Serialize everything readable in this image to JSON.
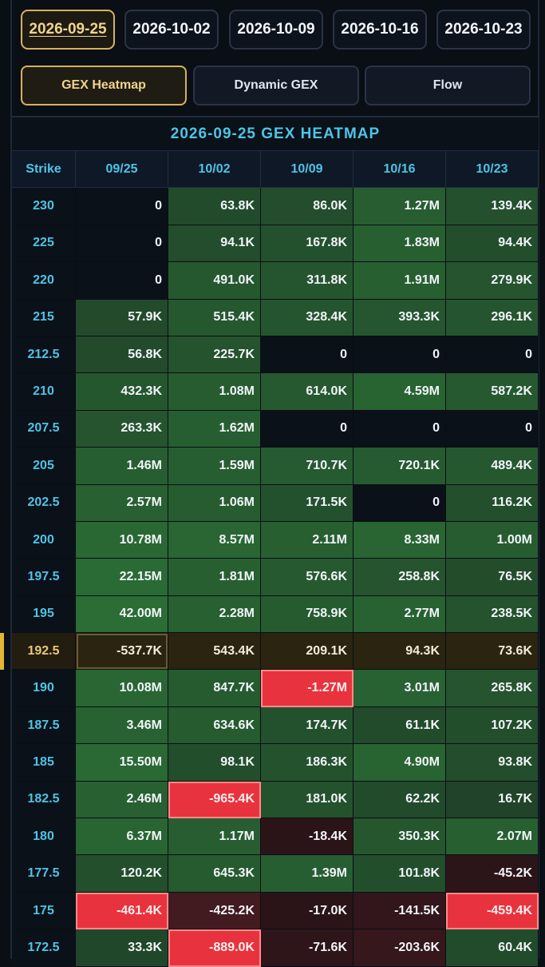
{
  "date_tabs": [
    {
      "label": "2026-09-25",
      "active": true
    },
    {
      "label": "2026-10-02",
      "active": false
    },
    {
      "label": "2026-10-09",
      "active": false
    },
    {
      "label": "2026-10-16",
      "active": false
    },
    {
      "label": "2026-10-23",
      "active": false
    }
  ],
  "view_tabs": [
    {
      "label": "GEX Heatmap",
      "active": true
    },
    {
      "label": "Dynamic GEX",
      "active": false
    },
    {
      "label": "Flow",
      "active": false
    }
  ],
  "heatmap": {
    "title": "2026-09-25 GEX HEATMAP",
    "strike_header": "Strike",
    "columns": [
      "09/25",
      "10/02",
      "10/09",
      "10/16",
      "10/23"
    ],
    "current_strike": "192.5",
    "rows": [
      {
        "strike": "230",
        "values": [
          "0",
          "63.8K",
          "86.0K",
          "1.27M",
          "139.4K"
        ],
        "numeric": [
          0,
          63800,
          86000,
          1270000,
          139400
        ]
      },
      {
        "strike": "225",
        "values": [
          "0",
          "94.1K",
          "167.8K",
          "1.83M",
          "94.4K"
        ],
        "numeric": [
          0,
          94100,
          167800,
          1830000,
          94400
        ]
      },
      {
        "strike": "220",
        "values": [
          "0",
          "491.0K",
          "311.8K",
          "1.91M",
          "279.9K"
        ],
        "numeric": [
          0,
          491000,
          311800,
          1910000,
          279900
        ]
      },
      {
        "strike": "215",
        "values": [
          "57.9K",
          "515.4K",
          "328.4K",
          "393.3K",
          "296.1K"
        ],
        "numeric": [
          57900,
          515400,
          328400,
          393300,
          296100
        ]
      },
      {
        "strike": "212.5",
        "values": [
          "56.8K",
          "225.7K",
          "0",
          "0",
          "0"
        ],
        "numeric": [
          56800,
          225700,
          0,
          0,
          0
        ]
      },
      {
        "strike": "210",
        "values": [
          "432.3K",
          "1.08M",
          "614.0K",
          "4.59M",
          "587.2K"
        ],
        "numeric": [
          432300,
          1080000,
          614000,
          4590000,
          587200
        ]
      },
      {
        "strike": "207.5",
        "values": [
          "263.3K",
          "1.62M",
          "0",
          "0",
          "0"
        ],
        "numeric": [
          263300,
          1620000,
          0,
          0,
          0
        ]
      },
      {
        "strike": "205",
        "values": [
          "1.46M",
          "1.59M",
          "710.7K",
          "720.1K",
          "489.4K"
        ],
        "numeric": [
          1460000,
          1590000,
          710700,
          720100,
          489400
        ]
      },
      {
        "strike": "202.5",
        "values": [
          "2.57M",
          "1.06M",
          "171.5K",
          "0",
          "116.2K"
        ],
        "numeric": [
          2570000,
          1060000,
          171500,
          0,
          116200
        ]
      },
      {
        "strike": "200",
        "values": [
          "10.78M",
          "8.57M",
          "2.11M",
          "8.33M",
          "1.00M"
        ],
        "numeric": [
          10780000,
          8570000,
          2110000,
          8330000,
          1000000
        ]
      },
      {
        "strike": "197.5",
        "values": [
          "22.15M",
          "1.81M",
          "576.6K",
          "258.8K",
          "76.5K"
        ],
        "numeric": [
          22150000,
          1810000,
          576600,
          258800,
          76500
        ]
      },
      {
        "strike": "195",
        "values": [
          "42.00M",
          "2.28M",
          "758.9K",
          "2.77M",
          "238.5K"
        ],
        "numeric": [
          42000000,
          2280000,
          758900,
          2770000,
          238500
        ]
      },
      {
        "strike": "192.5",
        "values": [
          "-537.7K",
          "543.4K",
          "209.1K",
          "94.3K",
          "73.6K"
        ],
        "numeric": [
          -537700,
          543400,
          209100,
          94300,
          73600
        ]
      },
      {
        "strike": "190",
        "values": [
          "10.08M",
          "847.7K",
          "-1.27M",
          "3.01M",
          "265.8K"
        ],
        "numeric": [
          10080000,
          847700,
          -1270000,
          3010000,
          265800
        ]
      },
      {
        "strike": "187.5",
        "values": [
          "3.46M",
          "634.6K",
          "174.7K",
          "61.1K",
          "107.2K"
        ],
        "numeric": [
          3460000,
          634600,
          174700,
          61100,
          107200
        ]
      },
      {
        "strike": "185",
        "values": [
          "15.50M",
          "98.1K",
          "186.3K",
          "4.90M",
          "93.8K"
        ],
        "numeric": [
          15500000,
          98100,
          186300,
          4900000,
          93800
        ]
      },
      {
        "strike": "182.5",
        "values": [
          "2.46M",
          "-965.4K",
          "181.0K",
          "62.2K",
          "16.7K"
        ],
        "numeric": [
          2460000,
          -965400,
          181000,
          62200,
          16700
        ]
      },
      {
        "strike": "180",
        "values": [
          "6.37M",
          "1.17M",
          "-18.4K",
          "350.3K",
          "2.07M"
        ],
        "numeric": [
          6370000,
          1170000,
          -18400,
          350300,
          2070000
        ]
      },
      {
        "strike": "177.5",
        "values": [
          "120.2K",
          "645.3K",
          "1.39M",
          "101.8K",
          "-45.2K"
        ],
        "numeric": [
          120200,
          645300,
          1390000,
          101800,
          -45200
        ]
      },
      {
        "strike": "175",
        "values": [
          "-461.4K",
          "-425.2K",
          "-17.0K",
          "-141.5K",
          "-459.4K"
        ],
        "numeric": [
          -461400,
          -425200,
          -17000,
          -141500,
          -459400
        ]
      },
      {
        "strike": "172.5",
        "values": [
          "33.3K",
          "-889.0K",
          "-71.6K",
          "-203.6K",
          "60.4K"
        ],
        "numeric": [
          33300,
          -889000,
          -71600,
          -203600,
          60400
        ]
      }
    ],
    "colors": {
      "zero": "#0b1119",
      "pos_low": "#1e3a26",
      "pos_mid": "#2f7d3a",
      "pos_high": "#5de84a",
      "neg_low": "#2a1418",
      "neg_high": "#e8333e",
      "accent_gold": "#d8b25a",
      "accent_cyan": "#4ec4e6"
    }
  }
}
